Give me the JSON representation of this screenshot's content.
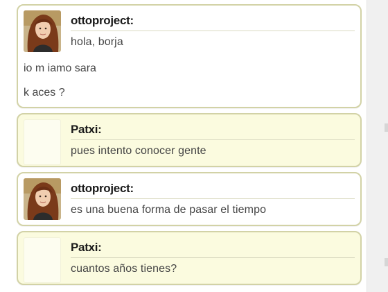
{
  "messages": [
    {
      "author": "ottoproject:",
      "lines": [
        "hola, borja",
        "io m iamo sara",
        "k aces ?"
      ],
      "avatar": "girl-avatar-icon",
      "style": "white"
    },
    {
      "author": "Patxi:",
      "lines": [
        "pues intento conocer gente"
      ],
      "avatar": "blank-avatar",
      "style": "yellow"
    },
    {
      "author": "ottoproject:",
      "lines": [
        "es una buena forma de pasar el tiempo"
      ],
      "avatar": "girl-avatar-icon",
      "style": "white"
    },
    {
      "author": "Patxi:",
      "lines": [
        "cuantos años tienes?"
      ],
      "avatar": "blank-avatar",
      "style": "yellow"
    }
  ],
  "colors": {
    "bubble_border": "#d2d2a6",
    "bubble_yellow": "#fbfbdf",
    "bubble_white": "#ffffff",
    "text": "#444444",
    "name": "#1a1a1a"
  }
}
